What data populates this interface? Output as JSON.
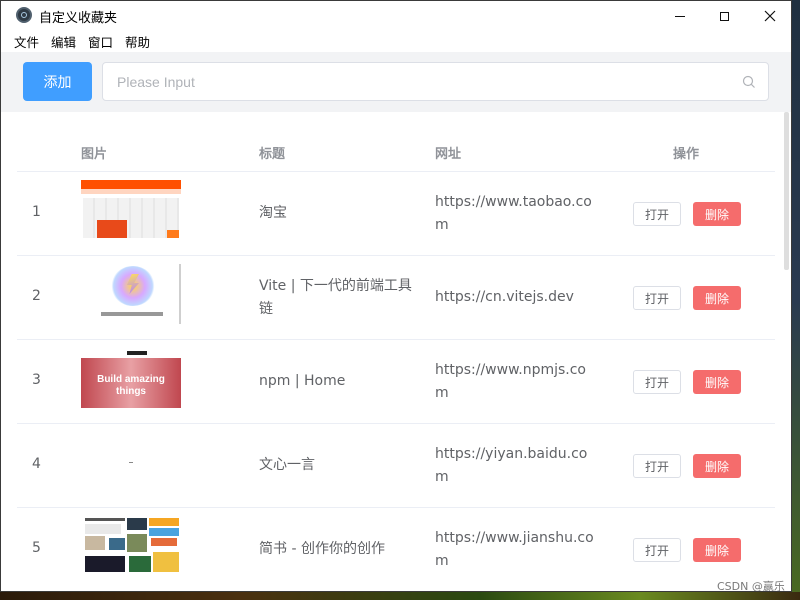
{
  "window": {
    "title": "自定义收藏夹"
  },
  "menu": [
    "文件",
    "编辑",
    "窗口",
    "帮助"
  ],
  "toolbar": {
    "add_label": "添加",
    "search_placeholder": "Please Input",
    "search_value": ""
  },
  "table": {
    "headers": {
      "image": "图片",
      "title": "标题",
      "url": "网址",
      "actions": "操作"
    },
    "rows": [
      {
        "index": "1",
        "title": "淘宝",
        "url": "https://www.taobao.com",
        "thumb": "taobao"
      },
      {
        "index": "2",
        "title": "Vite | 下一代的前端工具链",
        "url": "https://cn.vitejs.dev",
        "thumb": "vite"
      },
      {
        "index": "3",
        "title": "npm | Home",
        "url": "https://www.npmjs.com",
        "thumb": "npm"
      },
      {
        "index": "4",
        "title": "文心一言",
        "url": "https://yiyan.baidu.com",
        "thumb": "blank"
      },
      {
        "index": "5",
        "title": "简书 - 创作你的创作",
        "url": "https://www.jianshu.com",
        "thumb": "jianshu"
      }
    ],
    "open_label": "打开",
    "delete_label": "删除"
  },
  "thumbs": {
    "npm_text": "Build amazing things"
  },
  "watermark": "CSDN @赢乐",
  "colors": {
    "primary": "#409eff",
    "danger": "#f56c6c"
  }
}
